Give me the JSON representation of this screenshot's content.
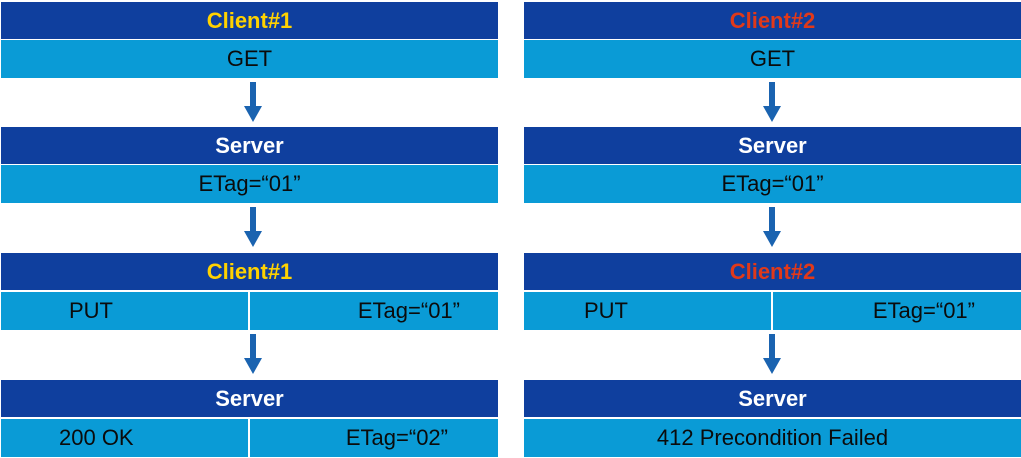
{
  "colors": {
    "header_bg": "#0f3f9e",
    "body_bg": "#0a9bd6",
    "arrow": "#1a63b0",
    "client1_text": "#ffd200",
    "client2_text": "#e0391a",
    "server_text": "#ffffff",
    "body_text": "#0b0b0b"
  },
  "left": {
    "block1": {
      "header": "Client#1",
      "body": "GET"
    },
    "block2": {
      "header": "Server",
      "body": "ETag=“01”"
    },
    "block3": {
      "header": "Client#1",
      "body_left": "PUT",
      "body_right": "ETag=“01”"
    },
    "block4": {
      "header": "Server",
      "body_left": "200 OK",
      "body_right": "ETag=“02”"
    }
  },
  "right": {
    "block1": {
      "header": "Client#2",
      "body": "GET"
    },
    "block2": {
      "header": "Server",
      "body": "ETag=“01”"
    },
    "block3": {
      "header": "Client#2",
      "body_left": "PUT",
      "body_right": "ETag=“01”"
    },
    "block4": {
      "header": "Server",
      "body": "412 Precondition Failed"
    }
  }
}
